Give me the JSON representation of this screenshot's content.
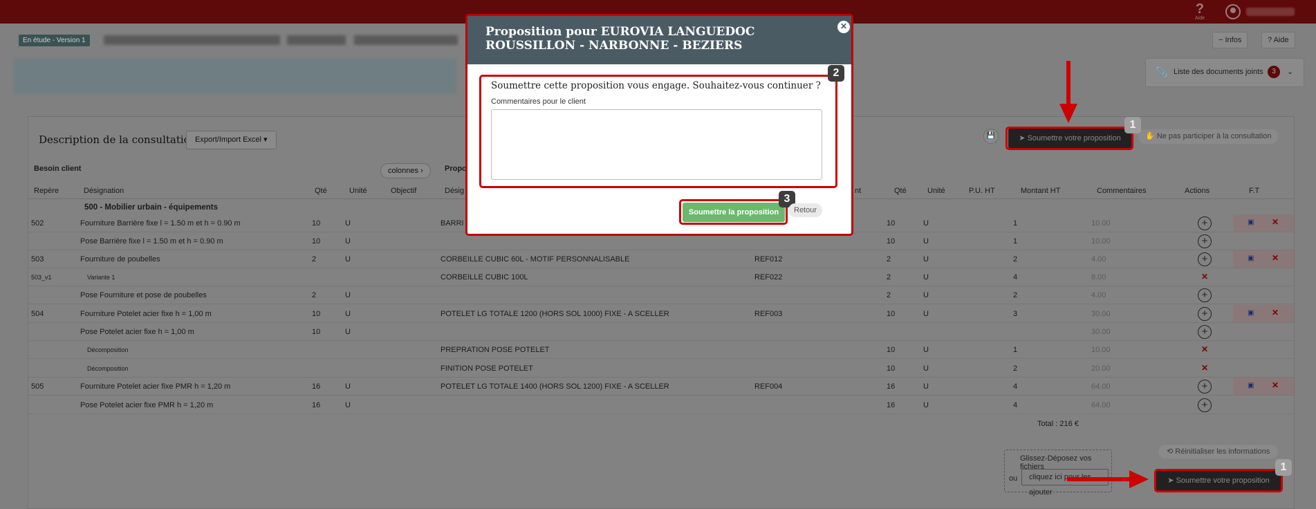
{
  "topbar": {
    "help_label": "Aide"
  },
  "subheader": {
    "status": "En étude - Version 1",
    "infos_label": "Infos",
    "aide_label": "Aide",
    "docs_label": "Liste des documents joints",
    "docs_count": "3"
  },
  "panel": {
    "title": "Description de la consultation",
    "export_label": "Export/Import Excel ▾",
    "submit_label": "Soumettre votre proposition",
    "no_participate_label": "Ne pas participer à la consultation",
    "group_left": "Besoin client",
    "group_right": "Propo",
    "colonnes_label": "colonnes ›"
  },
  "table": {
    "headers": {
      "repere": "Repère",
      "designation": "Désignation",
      "qte": "Qté",
      "unite": "Unité",
      "objectif": "Objectif",
      "designation2": "Désig",
      "ref_hidden": "nt",
      "qte2": "Qté",
      "unite2": "Unité",
      "pu": "P.U. HT",
      "montant": "Montant HT",
      "commentaires": "Commentaires",
      "actions": "Actions",
      "ft": "F.T"
    },
    "section": "500 - Mobilier urbain - équipements",
    "rows": [
      {
        "repere": "502",
        "designation": "Fourniture Barrière fixe l = 1.50 m et h = 0.90 m",
        "qte": "10",
        "unite": "U",
        "prop": "BARRI",
        "ref": "",
        "qte2": "10",
        "unite2": "U",
        "pu": "1",
        "montant": "10.00"
      },
      {
        "repere": "",
        "designation": "Pose Barrière fixe l = 1.50 m et h = 0.90 m",
        "qte": "10",
        "unite": "U",
        "prop": "",
        "ref": "",
        "qte2": "10",
        "unite2": "U",
        "pu": "1",
        "montant": "10.00"
      },
      {
        "repere": "503",
        "designation": "Fourniture de poubelles",
        "qte": "2",
        "unite": "U",
        "prop": "CORBEILLE CUBIC 60L - MOTIF PERSONNALISABLE",
        "ref": "REF012",
        "qte2": "2",
        "unite2": "U",
        "pu": "2",
        "montant": "4.00"
      },
      {
        "repere": "503_v1",
        "designation": "Variante 1",
        "qte": "",
        "unite": "",
        "prop": "CORBEILLE CUBIC 100L",
        "ref": "REF022",
        "qte2": "2",
        "unite2": "U",
        "pu": "4",
        "montant": "8.00"
      },
      {
        "repere": "",
        "designation": "Pose Fourniture et pose de poubelles",
        "qte": "2",
        "unite": "U",
        "prop": "",
        "ref": "",
        "qte2": "2",
        "unite2": "U",
        "pu": "2",
        "montant": "4.00"
      },
      {
        "repere": "504",
        "designation": "Fourniture Potelet acier fixe h = 1,00 m",
        "qte": "10",
        "unite": "U",
        "prop": "POTELET LG TOTALE 1200 (HORS SOL 1000) FIXE - A SCELLER",
        "ref": "REF003",
        "qte2": "10",
        "unite2": "U",
        "pu": "3",
        "montant": "30.00"
      },
      {
        "repere": "",
        "designation": "Pose Potelet acier fixe h = 1,00 m",
        "qte": "10",
        "unite": "U",
        "prop": "",
        "ref": "",
        "qte2": "",
        "unite2": "",
        "pu": "",
        "montant": "30.00"
      },
      {
        "repere": "",
        "designation": "Décomposition",
        "qte": "",
        "unite": "",
        "prop": "PREPRATION POSE POTELET",
        "ref": "",
        "qte2": "10",
        "unite2": "U",
        "pu": "1",
        "montant": "10.00"
      },
      {
        "repere": "",
        "designation": "Décomposition",
        "qte": "",
        "unite": "",
        "prop": "FINITION POSE POTELET",
        "ref": "",
        "qte2": "10",
        "unite2": "U",
        "pu": "2",
        "montant": "20.00"
      },
      {
        "repere": "505",
        "designation": "Fourniture Potelet acier fixe PMR h = 1,20 m",
        "qte": "16",
        "unite": "U",
        "prop": "POTELET  LG TOTALE 1400 (HORS SOL 1200) FIXE - A SCELLER",
        "ref": "REF004",
        "qte2": "16",
        "unite2": "U",
        "pu": "4",
        "montant": "64.00"
      },
      {
        "repere": "",
        "designation": "Pose Potelet acier fixe PMR h = 1,20 m",
        "qte": "16",
        "unite": "U",
        "prop": "",
        "ref": "",
        "qte2": "16",
        "unite2": "U",
        "pu": "4",
        "montant": "64.00"
      }
    ],
    "total": "Total : 216 €"
  },
  "bottom": {
    "drop_title": "Glissez-Déposez vos fichiers",
    "drop_or": "ou",
    "drop_button": "cliquez ici pour les ajouter",
    "reset_label": "Réinitialiser les informations",
    "submit_label": "Soumettre votre proposition"
  },
  "modal": {
    "title": "Proposition pour EUROVIA LANGUEDOC ROUSSILLON - NARBONNE - BEZIERS",
    "question": "Soumettre cette proposition vous engage. Souhaitez-vous continuer ?",
    "comment_label": "Commentaires pour le client",
    "comment_value": "",
    "submit_label": "Soumettre la proposition",
    "back_label": "Retour"
  },
  "steps": {
    "s1": "1",
    "s2": "2",
    "s3": "3"
  },
  "colors": {
    "highlight": "#cc0000",
    "topbar": "#5e0a0a",
    "modal_header": "#4a5b63",
    "submit_green": "#6bb86e"
  }
}
